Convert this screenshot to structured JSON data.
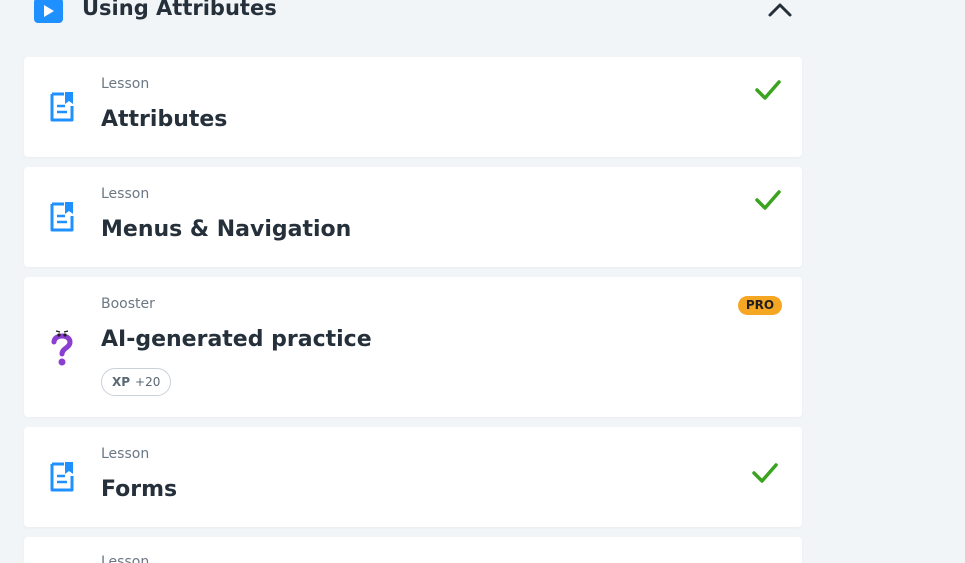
{
  "module": {
    "title": "Using Attributes",
    "icon": "play-icon",
    "collapse_icon": "chevron-up-icon",
    "accent": "#1e90ff"
  },
  "items": [
    {
      "kind": "Lesson",
      "title": "Attributes",
      "status": "completed",
      "icon": "lesson-doc-icon"
    },
    {
      "kind": "Lesson",
      "title": "Menus & Navigation",
      "status": "completed",
      "icon": "lesson-doc-icon"
    },
    {
      "kind": "Booster",
      "title": "AI-generated practice",
      "badge": "PRO",
      "xp_label": "XP",
      "xp_value": "+20",
      "icon": "question-mark-icon"
    },
    {
      "kind": "Lesson",
      "title": "Forms",
      "status": "completed",
      "icon": "lesson-doc-icon"
    },
    {
      "kind": "Lesson",
      "title": "",
      "icon": "lesson-doc-icon"
    }
  ],
  "colors": {
    "check": "#3aa31f",
    "pro_badge": "#f5a623",
    "lesson_icon": "#1e90ff",
    "booster_icon": "#8a3fd1"
  }
}
